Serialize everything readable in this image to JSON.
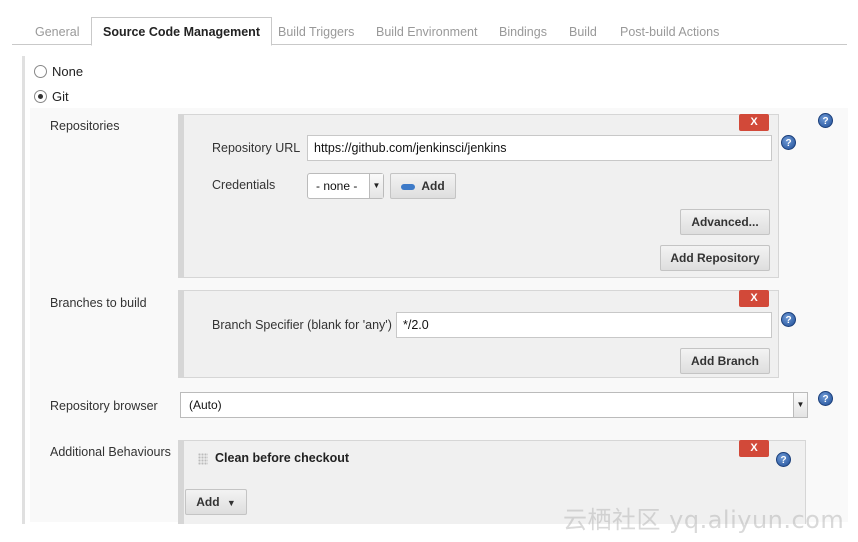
{
  "tabs": [
    {
      "label": "General",
      "active": false
    },
    {
      "label": "Source Code Management",
      "active": true
    },
    {
      "label": "Build Triggers",
      "active": false
    },
    {
      "label": "Build Environment",
      "active": false
    },
    {
      "label": "Bindings",
      "active": false
    },
    {
      "label": "Build",
      "active": false
    },
    {
      "label": "Post-build Actions",
      "active": false
    }
  ],
  "scm": {
    "options": [
      {
        "label": "None",
        "selected": false
      },
      {
        "label": "Git",
        "selected": true
      }
    ]
  },
  "repositories": {
    "section_label": "Repositories",
    "delete_label": "X",
    "url_label": "Repository URL",
    "url_value": "https://github.com/jenkinsci/jenkins",
    "credentials_label": "Credentials",
    "credentials_value": "- none -",
    "add_credentials_label": "Add",
    "advanced_label": "Advanced...",
    "add_repository_label": "Add Repository"
  },
  "branches": {
    "section_label": "Branches to build",
    "delete_label": "X",
    "specifier_label": "Branch Specifier (blank for 'any')",
    "specifier_value": "*/2.0",
    "add_branch_label": "Add Branch"
  },
  "repo_browser": {
    "label": "Repository browser",
    "value": "(Auto)"
  },
  "behaviours": {
    "label": "Additional Behaviours",
    "delete_label": "X",
    "item_title": "Clean before checkout",
    "add_label": "Add"
  },
  "help_glyph": "?",
  "watermark": "云栖社区 yq.aliyun.com",
  "colors": {
    "delete_red": "#d24939",
    "help_blue": "#2f62b0",
    "panel_bg": "#f0f0f0"
  }
}
